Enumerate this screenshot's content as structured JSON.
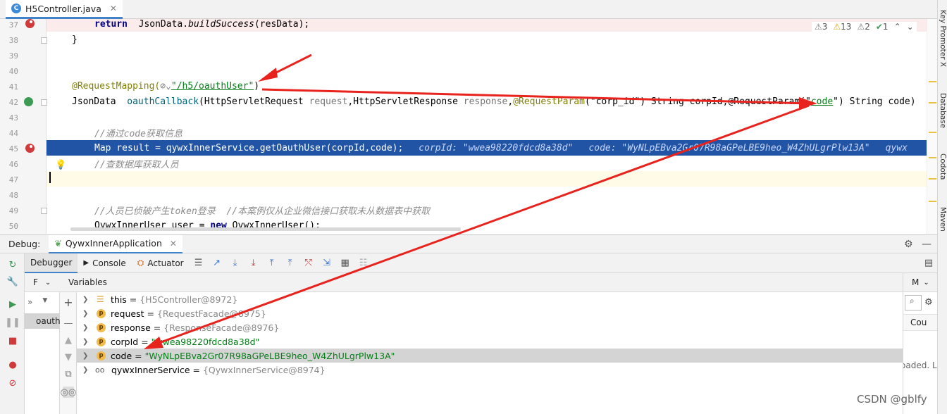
{
  "tab": {
    "label": "H5Controller.java"
  },
  "editor": {
    "lines": [
      {
        "num": "37",
        "code": "return  JsonData.buildSuccess(resData);"
      },
      {
        "num": "38",
        "code": "}"
      },
      {
        "num": "39",
        "code": ""
      },
      {
        "num": "40",
        "code": ""
      },
      {
        "num": "41",
        "annotation": "@RequestMapping(",
        "path": "\"/h5/oauthUser\"",
        "close": ")"
      },
      {
        "num": "42",
        "code": ""
      },
      {
        "num": "43",
        "code": ""
      },
      {
        "num": "44",
        "comment": "//通过code获取信息"
      },
      {
        "num": "45",
        "code": "Map result = qywxInnerService.getOauthUser(corpId,code);",
        "inlay1": "corpId: \"wwea98220fdcd8a38d\"",
        "inlay2": "code: \"WyNLpEBva2Gr07R98aGPeLBE9heo_W4ZhULgrPlw13A\"",
        "inlay3": "qywx"
      },
      {
        "num": "46",
        "comment": "//查数据库获取人员"
      },
      {
        "num": "47",
        "code": ""
      },
      {
        "num": "48",
        "code": ""
      },
      {
        "num": "49",
        "comment": "//人员已侦破产生token登录  //本案例仅从企业微信接口获取未从数据表中获取"
      },
      {
        "num": "50",
        "code": "QywxInnerUser user = new QywxInnerUser();"
      }
    ],
    "line42": {
      "a": "JsonData  ",
      "b": "oauthCallback",
      "c": "(HttpServletRequest ",
      "d": "request",
      "e": ",HttpServletResponse ",
      "f": "response",
      "g": ",",
      "h": "@RequestParam",
      "i": "(\"corp_id\") String corpId,@RequestParam",
      "j": "(\"",
      "k": "code",
      "l": "\") String code)"
    },
    "inspections": {
      "warn1": "3",
      "warn2": "13",
      "weak": "2",
      "ok": "1"
    }
  },
  "right_strip": {
    "items": [
      "Key Promoter X",
      "Database",
      "Codota",
      "Maven"
    ]
  },
  "debug": {
    "label": "Debug:",
    "config": "QywxInnerApplication",
    "tabs": [
      "Debugger",
      "Console",
      "Actuator"
    ],
    "frames_pane_label": "F",
    "frame_item": "oauth",
    "variables_header": "Variables",
    "right_pane_header": "M",
    "right_pane_text": "Cou",
    "right_pane_footer": "oaded. L",
    "variables": [
      {
        "name": "this",
        "value": "{H5Controller@8972}",
        "kind": "this"
      },
      {
        "name": "request",
        "value": "{RequestFacade@8975}",
        "kind": "p"
      },
      {
        "name": "response",
        "value": "{ResponseFacade@8976}",
        "kind": "p"
      },
      {
        "name": "corpId",
        "value": "\"wwea98220fdcd8a38d\"",
        "kind": "p"
      },
      {
        "name": "code",
        "value": "\"WyNLpEBva2Gr07R98aGPeLBE9heo_W4ZhULgrPlw13A\"",
        "kind": "p",
        "selected": true
      },
      {
        "name": "qywxInnerService",
        "value": "{QywxInnerService@8974}",
        "kind": "oo"
      }
    ]
  },
  "watermark": "CSDN @gblfy",
  "colors": {
    "arrow": "#e8231d",
    "selection": "#2154a5",
    "accent": "#4083c9"
  }
}
